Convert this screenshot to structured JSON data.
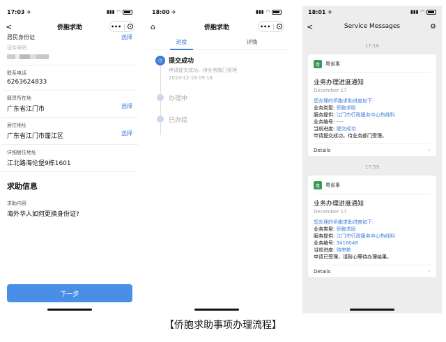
{
  "phone1": {
    "status": {
      "time": "17:03",
      "arrow": "✈"
    },
    "nav": {
      "back": "<",
      "title": "侨胞求助",
      "more": "•••"
    },
    "cut": {
      "label": "居民身份证",
      "action": "选择"
    },
    "fields": [
      {
        "label": "证件号码",
        "value": "",
        "masked": true
      },
      {
        "label": "联系电话",
        "value": "6263624833"
      },
      {
        "label": "籍贯所在地",
        "value": "广东省江门市",
        "action": "选择"
      },
      {
        "label": "居住地址",
        "value": "广东省江门市蓬江区",
        "action": "选择"
      },
      {
        "label": "详细居住地址",
        "value": "江北路海伦堡9栋1601"
      }
    ],
    "section_title": "求助信息",
    "help": {
      "label": "求助内容",
      "value": "海外华人如何更换身份证?"
    },
    "next_button": "下一步"
  },
  "phone2": {
    "status": {
      "time": "18:00",
      "arrow": "✈"
    },
    "nav": {
      "title": "侨胞求助",
      "more": "•••"
    },
    "tabs": [
      "进度",
      "详情"
    ],
    "timeline": [
      {
        "title": "提交成功",
        "desc": "申请提交成功，待业务部门受理",
        "time": "2019-12-18 09:18"
      },
      {
        "title": "办理中"
      },
      {
        "title": "已办结"
      }
    ]
  },
  "phone3": {
    "status": {
      "time": "18:01",
      "arrow": "✈"
    },
    "nav": {
      "back": "<",
      "title": "Service Messages"
    },
    "messages": [
      {
        "time": "17:16",
        "sender": "粤省事",
        "title": "业务办理进度通知",
        "date": "December 17",
        "intro": "您办理的侨胞求助进度如下:",
        "lines": [
          {
            "k": "业务类型: ",
            "v": "侨胞求助"
          },
          {
            "k": "服务提供: ",
            "v": "江门市行政服务中心热线科"
          },
          {
            "k": "业务编号: ",
            "v": "----"
          },
          {
            "k": "当前进度: ",
            "v": "提交成功"
          }
        ],
        "outro": "申请提交成功，待业务部门受理。",
        "details": "Details"
      },
      {
        "time": "17:59",
        "sender": "粤省事",
        "title": "业务办理进度通知",
        "date": "December 17",
        "intro": "您办理的侨胞求助进度如下:",
        "lines": [
          {
            "k": "业务类型: ",
            "v": "侨胞求助"
          },
          {
            "k": "服务提供: ",
            "v": "江门市行政服务中心热线科"
          },
          {
            "k": "业务编号: ",
            "v": "3416048"
          },
          {
            "k": "当前进度: ",
            "v": "待审核"
          }
        ],
        "outro": "申请已受理，请耐心等待办理结果。",
        "details": "Details"
      }
    ]
  },
  "caption": "【侨胞求助事项办理流程】"
}
